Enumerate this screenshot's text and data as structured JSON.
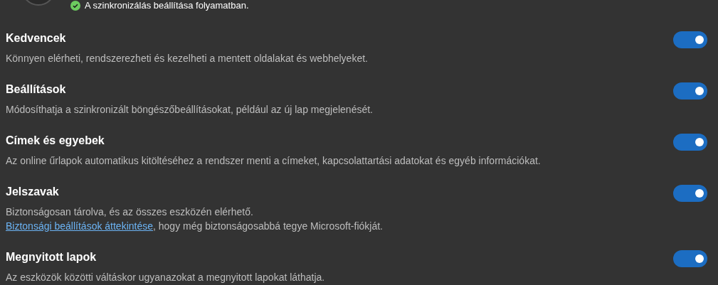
{
  "sync_status": {
    "text": "A szinkronizálás beállítása folyamatban."
  },
  "items": [
    {
      "title": "Kedvencek",
      "description": "Könnyen elérheti, rendszerezheti és kezelheti a mentett oldalakat és webhelyeket.",
      "on": true
    },
    {
      "title": "Beállítások",
      "description": "Módosíthatja a szinkronizált böngészőbeállításokat, például az új lap megjelenését.",
      "on": true
    },
    {
      "title": "Címek és egyebek",
      "description": "Az online űrlapok automatikus kitöltéséhez a rendszer menti a címeket, kapcsolattartási adatokat és egyéb információkat.",
      "on": true
    },
    {
      "title": "Jelszavak",
      "description": "Biztonságosan tárolva, és az összes eszközén elérhető.",
      "link": "Biztonsági beállítások áttekintése",
      "link_suffix": ", hogy még biztonságosabbá tegye Microsoft-fiókját.",
      "on": true
    },
    {
      "title": "Megnyitott lapok",
      "description": "Az eszközök közötti váltáskor ugyanazokat a megnyitott lapokat láthatja.",
      "on": true
    }
  ]
}
